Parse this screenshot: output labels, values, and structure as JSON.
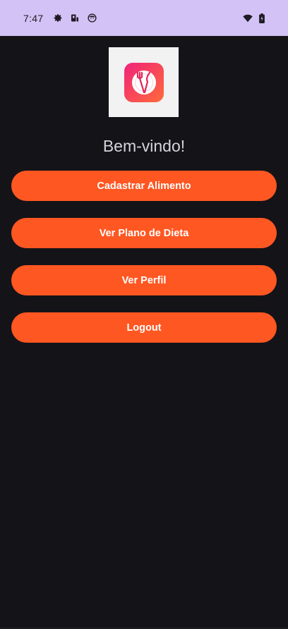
{
  "status_bar": {
    "time": "7:47",
    "left_icons": [
      "gear-icon",
      "sim-icon",
      "face-icon"
    ],
    "right_icons": [
      "wifi-icon",
      "battery-icon"
    ],
    "background": "#d3c2f5"
  },
  "app": {
    "logo_icon": "fork-knife-plate-icon",
    "welcome_text": "Bem-vindo!",
    "buttons": [
      {
        "label": "Cadastrar Alimento"
      },
      {
        "label": "Ver Plano de Dieta"
      },
      {
        "label": "Ver Perfil"
      },
      {
        "label": "Logout"
      }
    ],
    "accent_color": "#ff5722",
    "background": "#141318"
  }
}
